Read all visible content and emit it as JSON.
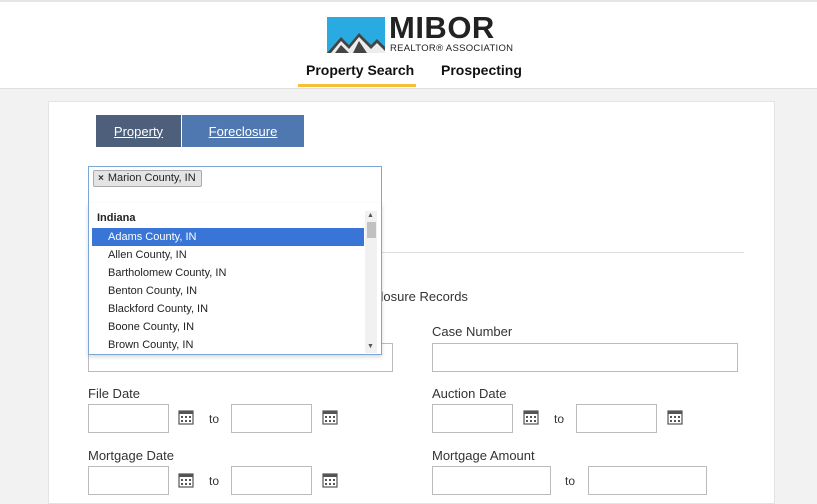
{
  "header": {
    "logo": {
      "name": "MIBOR",
      "subtitle": "REALTOR® ASSOCIATION"
    },
    "nav": [
      {
        "label": "Property Search",
        "active": true
      },
      {
        "label": "Prospecting",
        "active": false
      }
    ],
    "accent_color": "#f5c035"
  },
  "tabs": [
    {
      "label": "Property",
      "color": "#4d5f7a"
    },
    {
      "label": "Foreclosure",
      "color": "#4f78b0"
    }
  ],
  "county_select": {
    "selected_chip": "Marion County, IN",
    "chip_remove_icon": "close-icon",
    "group_label": "Indiana",
    "options": [
      {
        "label": "Adams County, IN",
        "highlighted": true
      },
      {
        "label": "Allen County, IN",
        "highlighted": false
      },
      {
        "label": "Bartholomew County, IN",
        "highlighted": false
      },
      {
        "label": "Benton County, IN",
        "highlighted": false
      },
      {
        "label": "Blackford County, IN",
        "highlighted": false
      },
      {
        "label": "Boone County, IN",
        "highlighted": false
      },
      {
        "label": "Brown County, IN",
        "highlighted": false
      }
    ],
    "highlight_color": "#3875d7"
  },
  "form": {
    "records_text": "closure Records",
    "case_number_label": "Case Number",
    "file_date_label": "File Date",
    "auction_date_label": "Auction Date",
    "mortgage_date_label": "Mortgage Date",
    "mortgage_amount_label": "Mortgage Amount",
    "to_label": "to",
    "calendar_icon": "calendar-icon"
  }
}
